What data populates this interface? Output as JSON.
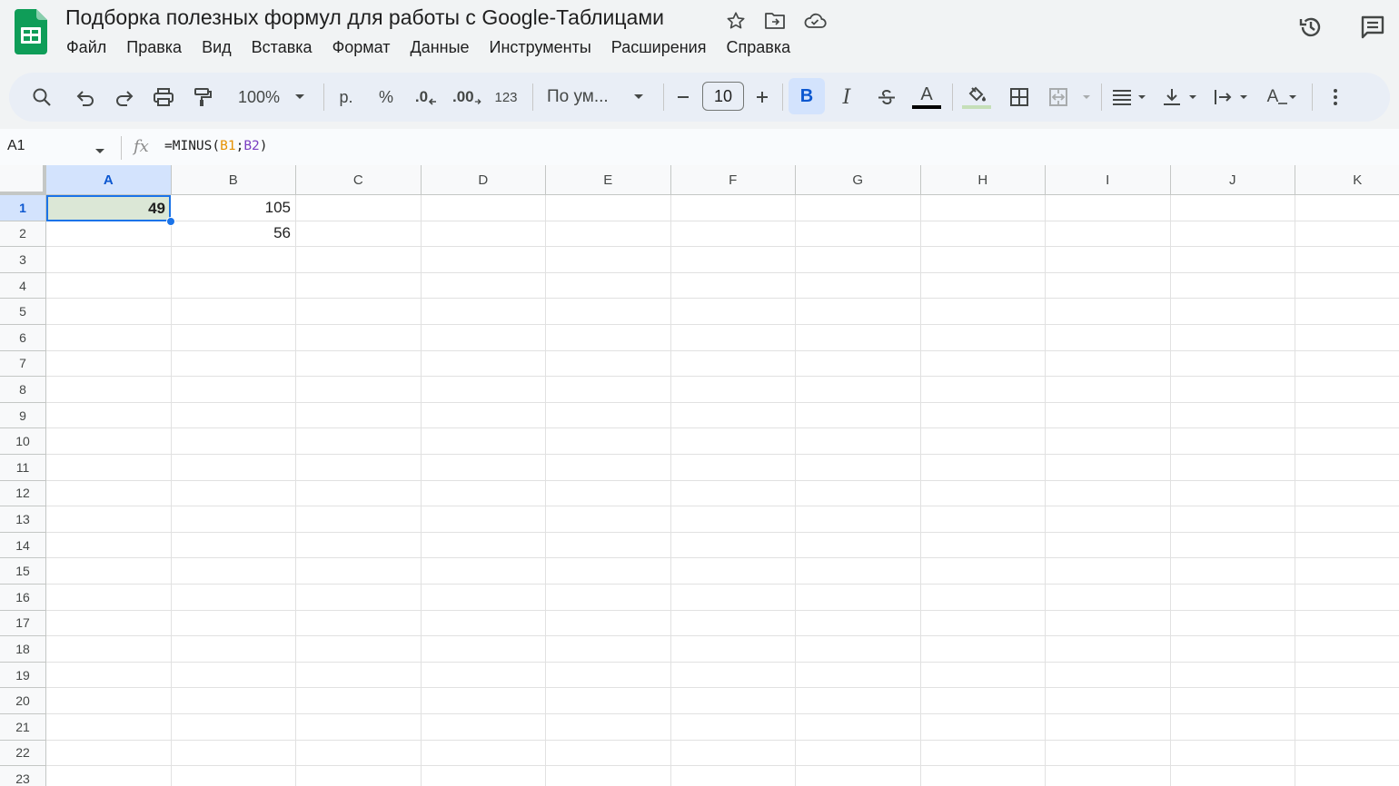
{
  "doc": {
    "title": "Подборка полезных формул для работы с Google-Таблицами"
  },
  "menu": [
    "Файл",
    "Правка",
    "Вид",
    "Вставка",
    "Формат",
    "Данные",
    "Инструменты",
    "Расширения",
    "Справка"
  ],
  "toolbar": {
    "zoom": "100%",
    "currency": "р.",
    "percent": "%",
    "decrease_decimals": ".0",
    "increase_decimals": ".00",
    "more_formats": "123",
    "font_name": "По ум...",
    "font_size": "10",
    "bold": "B",
    "italic": "I",
    "text_color_letter": "A",
    "text_rotation_letter": "A"
  },
  "formula_bar": {
    "name_box": "A1",
    "fx": "fx",
    "formula_prefix": "=MINUS(",
    "ref1": "B1",
    "separator": ";",
    "ref2": "B2",
    "formula_suffix": ")"
  },
  "grid": {
    "columns": [
      "A",
      "B",
      "C",
      "D",
      "E",
      "F",
      "G",
      "H",
      "I",
      "J",
      "K"
    ],
    "rows": [
      "1",
      "2",
      "3",
      "4",
      "5",
      "6",
      "7",
      "8",
      "9",
      "10",
      "11",
      "12",
      "13",
      "14",
      "15",
      "16",
      "17",
      "18",
      "19",
      "20",
      "21",
      "22",
      "23"
    ],
    "selected_column": "A",
    "selected_row": "1",
    "cells": {
      "A1": "49",
      "B1": "105",
      "B2": "56"
    }
  },
  "colors": {
    "selection_blue": "#1a73e8",
    "header_selected": "#d3e3fd",
    "cell_a1_fill": "#dbe7d6",
    "sheets_green": "#0f9d58"
  },
  "icons": {
    "logo": "google-sheets-logo",
    "star": "star-icon",
    "move": "folder-move-icon",
    "cloud": "cloud-status-icon",
    "history": "history-icon",
    "comments": "comments-icon"
  }
}
